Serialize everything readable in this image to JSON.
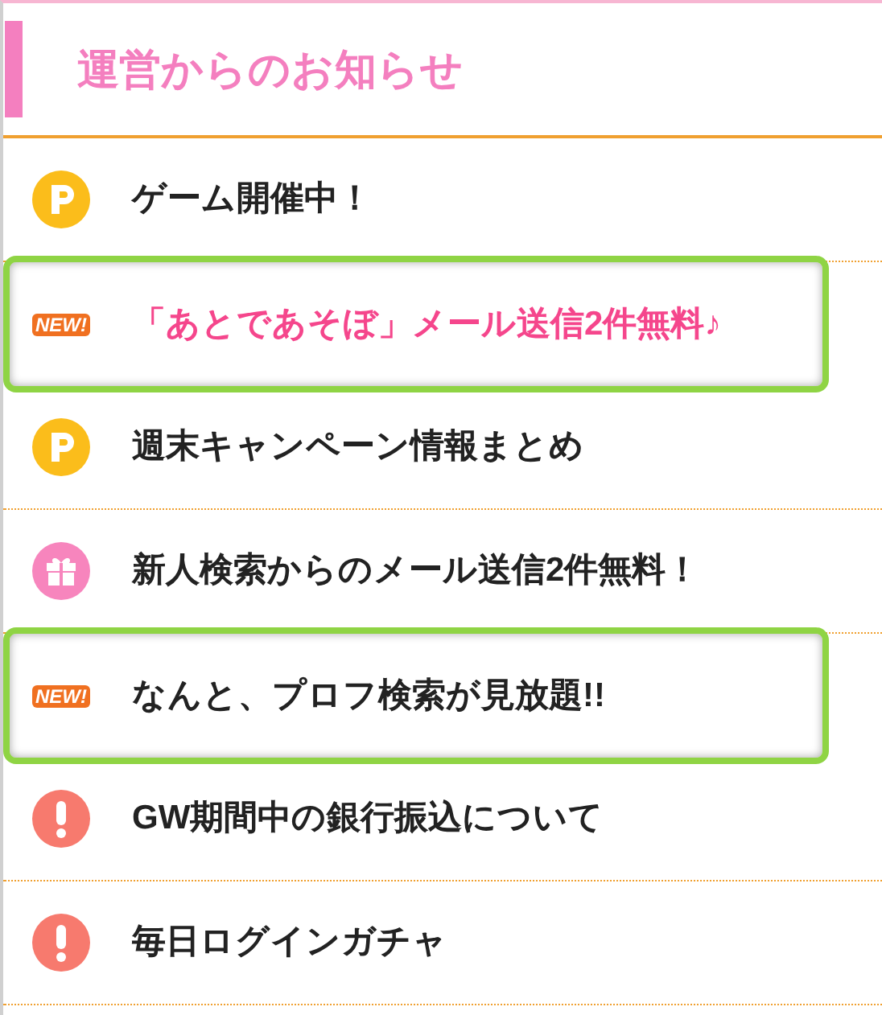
{
  "header": {
    "title": "運営からのお知らせ"
  },
  "notices": [
    {
      "kind": "points",
      "label": "ゲーム開催中！",
      "highlighted": false,
      "emphasized": false
    },
    {
      "kind": "new",
      "badge": "NEW!",
      "label": "「あとであそぼ」メール送信2件無料♪",
      "highlighted": true,
      "emphasized": true
    },
    {
      "kind": "points",
      "label": "週末キャンペーン情報まとめ",
      "highlighted": false,
      "emphasized": false
    },
    {
      "kind": "gift",
      "label": "新人検索からのメール送信2件無料！",
      "highlighted": false,
      "emphasized": false
    },
    {
      "kind": "new",
      "badge": "NEW!",
      "label": "なんと、プロフ検索が見放題!!",
      "highlighted": true,
      "emphasized": false
    },
    {
      "kind": "alert",
      "label": "GW期間中の銀行振込について",
      "highlighted": false,
      "emphasized": false
    },
    {
      "kind": "alert",
      "label": "毎日ログインガチャ",
      "highlighted": false,
      "emphasized": false
    }
  ]
}
